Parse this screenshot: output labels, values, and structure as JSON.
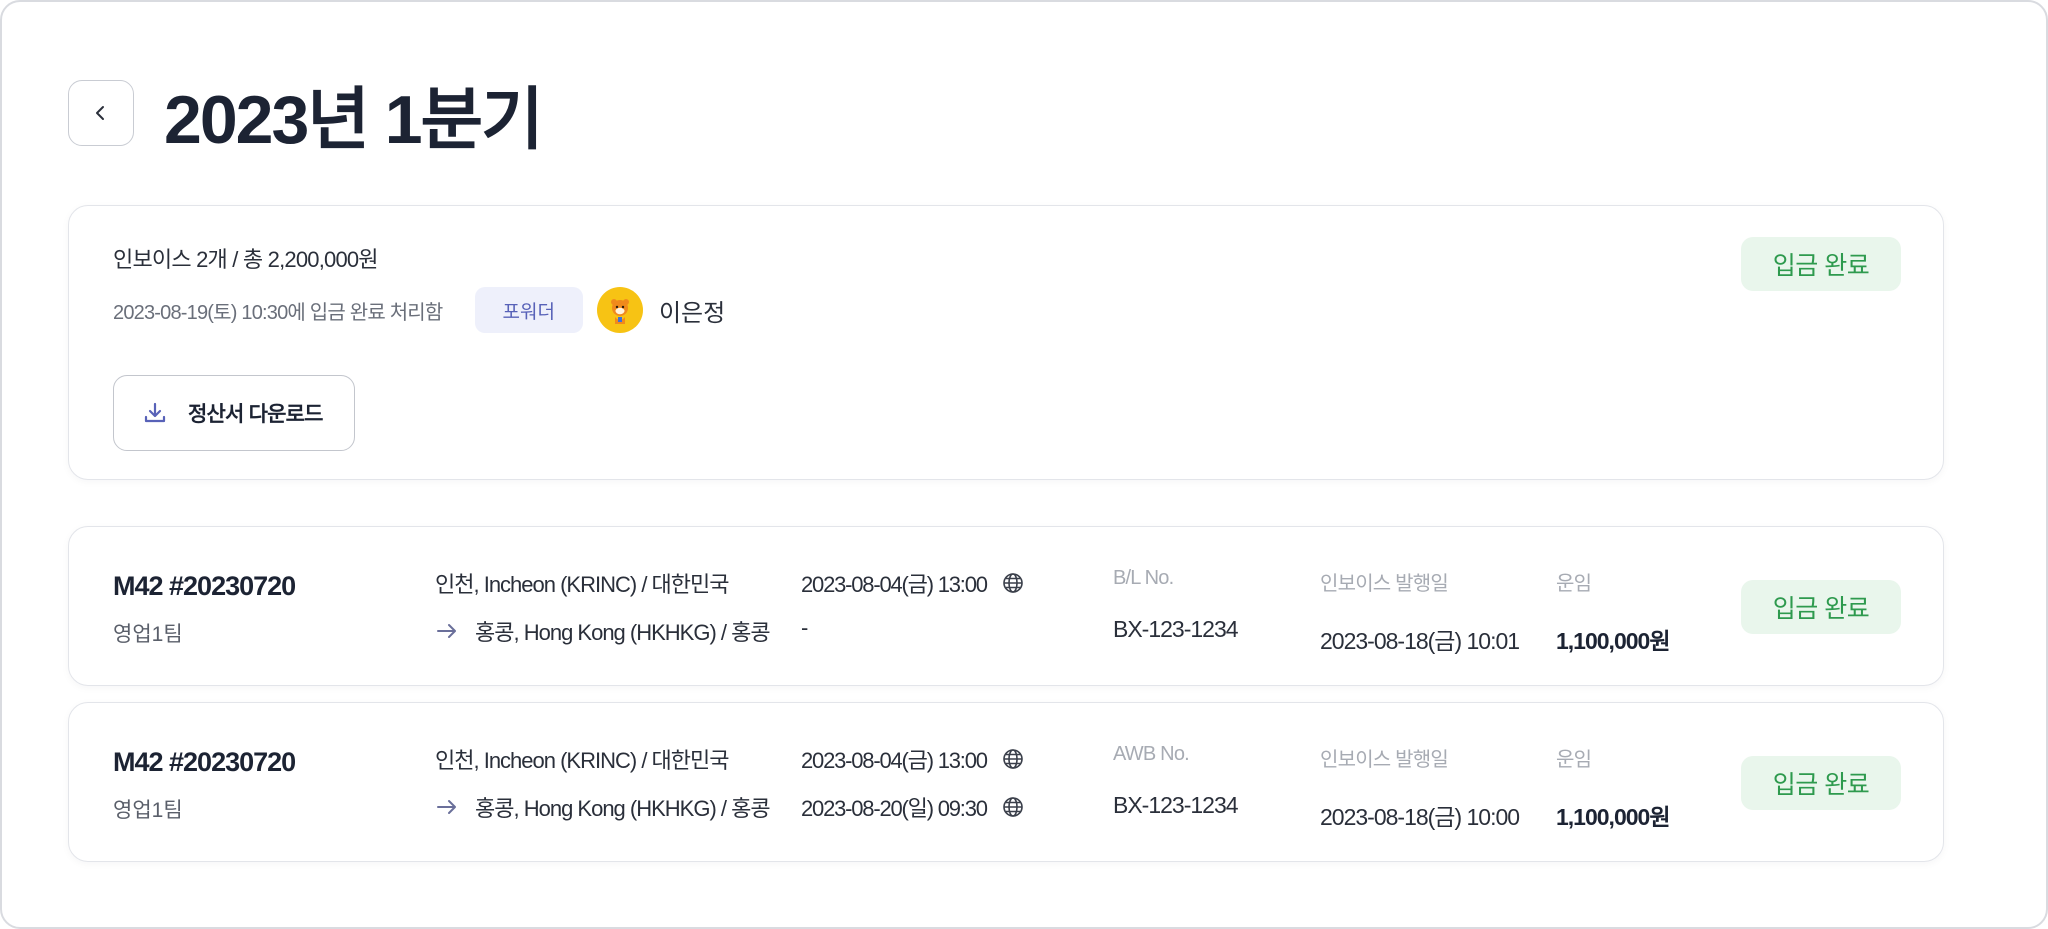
{
  "page": {
    "title": "2023년 1분기"
  },
  "summary": {
    "title": "인보이스 2개 / 총 2,200,000원",
    "processed": "2023-08-19(토) 10:30에 입금 완료 처리함",
    "role": "포워더",
    "user": "이은정",
    "download_label": "정산서 다운로드",
    "status": "입금 완료"
  },
  "shipments": [
    {
      "id": "M42 #20230720",
      "team": "영업1팀",
      "origin": "인천, Incheon (KRINC) / 대한민국",
      "destination": "홍콩, Hong Kong (HKHKG) / 홍콩",
      "departure": "2023-08-04(금) 13:00",
      "arrival": "-",
      "doc_label": "B/L No.",
      "doc_no": "BX-123-1234",
      "issue_label": "인보이스 발행일",
      "issue_date": "2023-08-18(금) 10:01",
      "fare_label": "운임",
      "fare": "1,100,000원",
      "status": "입금 완료"
    },
    {
      "id": "M42 #20230720",
      "team": "영업1팀",
      "origin": "인천, Incheon (KRINC) / 대한민국",
      "destination": "홍콩, Hong Kong (HKHKG) / 홍콩",
      "departure": "2023-08-04(금) 13:00",
      "arrival": "2023-08-20(일) 09:30",
      "doc_label": "AWB No.",
      "doc_no": "BX-123-1234",
      "issue_label": "인보이스 발행일",
      "issue_date": "2023-08-18(금) 10:00",
      "fare_label": "운임",
      "fare": "1,100,000원",
      "status": "입금 완료"
    }
  ],
  "colors": {
    "status_bg": "#e9f6ec",
    "status_text": "#2e9a4e",
    "accent": "#5862b8"
  },
  "icons": [
    "chevron-left-icon",
    "download-icon",
    "arrow-right-icon",
    "globe-icon"
  ]
}
